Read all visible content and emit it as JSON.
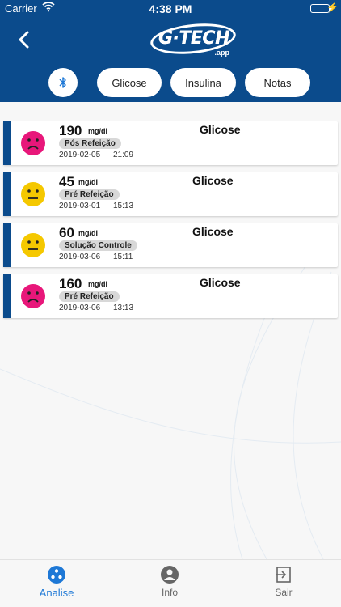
{
  "status_bar": {
    "carrier": "Carrier",
    "time": "4:38 PM"
  },
  "header": {
    "logo_text": "G·TECH",
    "logo_sub": ".app",
    "back_icon": "chevron-left-icon"
  },
  "filters": {
    "bluetooth_icon": "bluetooth-icon",
    "items": [
      {
        "label": "Glicose"
      },
      {
        "label": "Insulina"
      },
      {
        "label": "Notas"
      }
    ]
  },
  "records": [
    {
      "value": "190",
      "unit": "mg/dl",
      "type": "Glicose",
      "tag": "Pós Refeição",
      "date": "2019-02-05",
      "hour": "21:09",
      "mood": "sad",
      "color": "#e8177a"
    },
    {
      "value": "45",
      "unit": "mg/dl",
      "type": "Glicose",
      "tag": "Pré Refeição",
      "date": "2019-03-01",
      "hour": "15:13",
      "mood": "neutral",
      "color": "#f5c800"
    },
    {
      "value": "60",
      "unit": "mg/dl",
      "type": "Glicose",
      "tag": "Solução Controle",
      "date": "2019-03-06",
      "hour": "15:11",
      "mood": "neutral",
      "color": "#f5c800"
    },
    {
      "value": "160",
      "unit": "mg/dl",
      "type": "Glicose",
      "tag": "Pré Refeição",
      "date": "2019-03-06",
      "hour": "13:13",
      "mood": "sad",
      "color": "#e8177a"
    }
  ],
  "tabbar": {
    "items": [
      {
        "label": "Analise",
        "icon": "analysis-icon",
        "active": true
      },
      {
        "label": "Info",
        "icon": "person-icon",
        "active": false
      },
      {
        "label": "Sair",
        "icon": "exit-icon",
        "active": false
      }
    ]
  },
  "colors": {
    "primary": "#0b4b8c",
    "accent": "#1e78d6",
    "sad": "#e8177a",
    "neutral": "#f5c800"
  }
}
